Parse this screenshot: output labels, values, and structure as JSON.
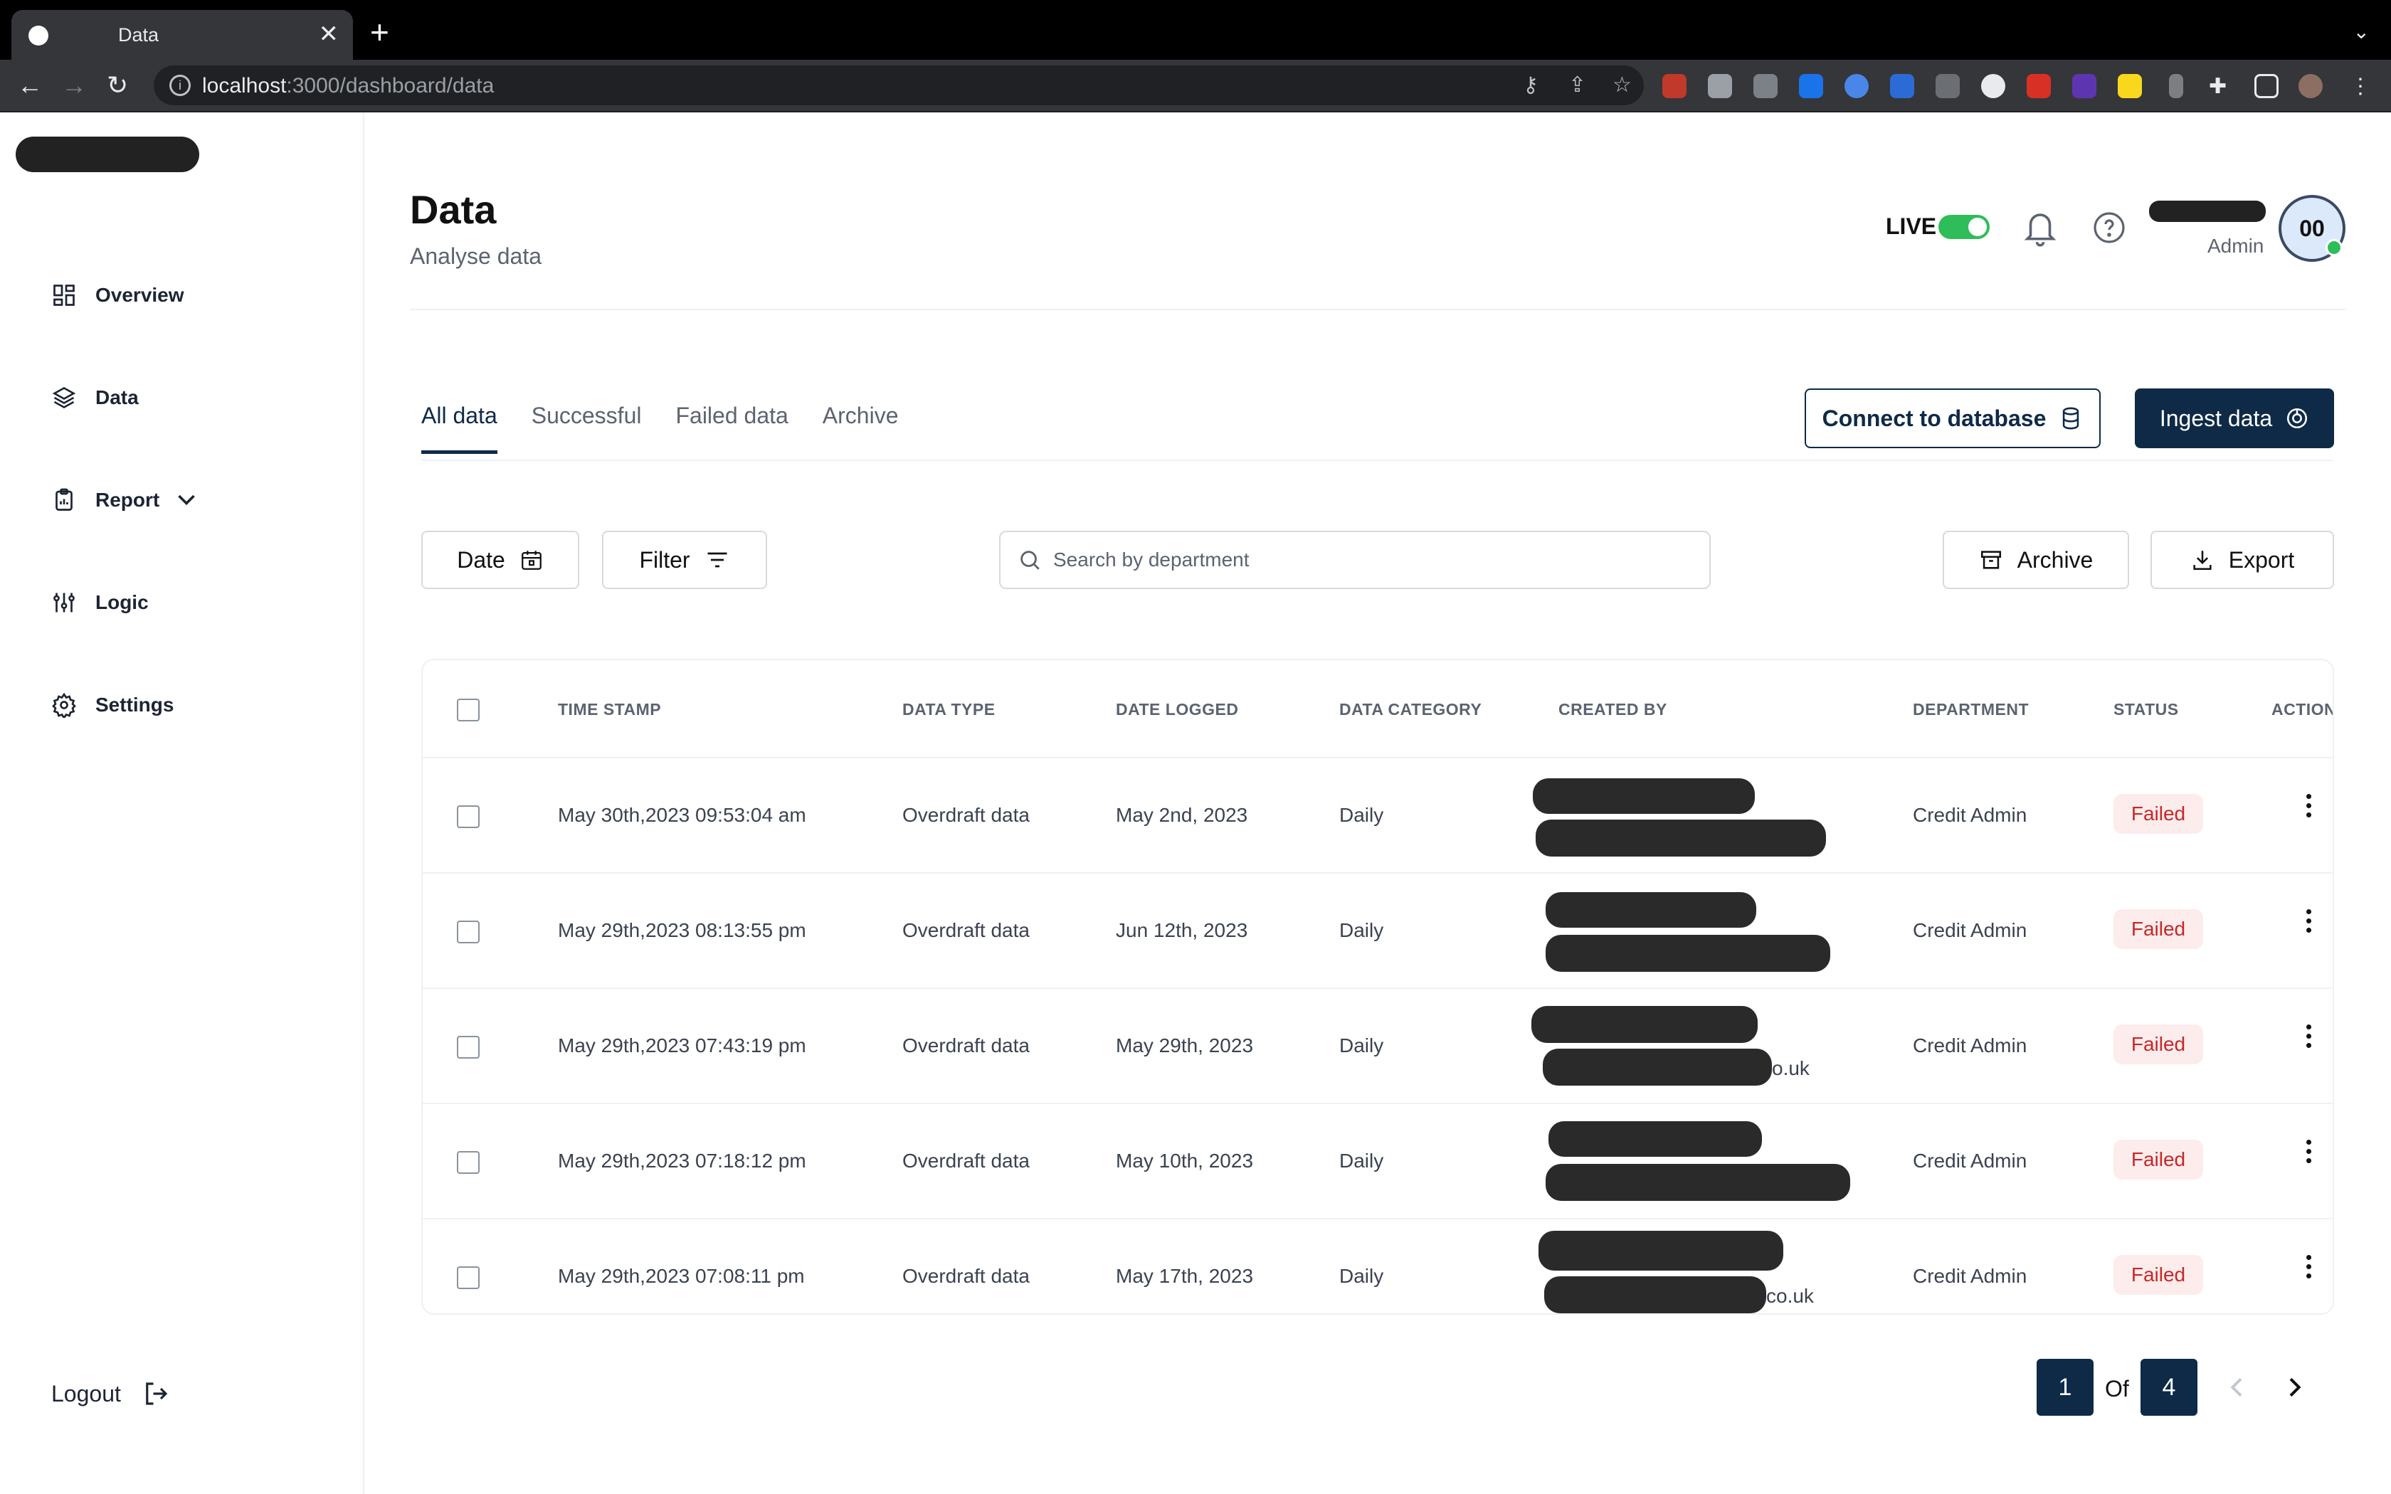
{
  "browser": {
    "tab_title": "Data",
    "url_host": "localhost",
    "url_path": ":3000/dashboard/data"
  },
  "sidebar": {
    "items": [
      {
        "label": "Overview",
        "icon": "grid-icon"
      },
      {
        "label": "Data",
        "icon": "layers-icon"
      },
      {
        "label": "Report",
        "icon": "clipboard-icon"
      },
      {
        "label": "Logic",
        "icon": "sliders-icon"
      },
      {
        "label": "Settings",
        "icon": "gear-icon"
      }
    ],
    "logout_label": "Logout"
  },
  "header": {
    "title": "Data",
    "subtitle": "Analyse data",
    "live_label": "LIVE",
    "live_on": true,
    "user_role": "Admin",
    "avatar_initials": "00"
  },
  "tabs": [
    "All data",
    "Successful",
    "Failed data",
    "Archive"
  ],
  "actions": {
    "connect_label": "Connect to database",
    "ingest_label": "Ingest data",
    "date_label": "Date",
    "filter_label": "Filter",
    "search_placeholder": "Search by department",
    "archive_label": "Archive",
    "export_label": "Export"
  },
  "table": {
    "headers": [
      "TIME STAMP",
      "DATA TYPE",
      "DATE LOGGED",
      "DATA CATEGORY",
      "CREATED BY",
      "DEPARTMENT",
      "STATUS",
      "ACTION"
    ],
    "rows": [
      {
        "timestamp": "May 30th,2023 09:53:04 am",
        "type": "Overdraft data",
        "logged": "May 2nd, 2023",
        "category": "Daily",
        "created_suffix": "",
        "department": "Credit Admin",
        "status": "Failed"
      },
      {
        "timestamp": "May 29th,2023 08:13:55 pm",
        "type": "Overdraft data",
        "logged": "Jun 12th, 2023",
        "category": "Daily",
        "created_suffix": "",
        "department": "Credit Admin",
        "status": "Failed"
      },
      {
        "timestamp": "May 29th,2023 07:43:19 pm",
        "type": "Overdraft data",
        "logged": "May 29th, 2023",
        "category": "Daily",
        "created_suffix": "o.uk",
        "department": "Credit Admin",
        "status": "Failed"
      },
      {
        "timestamp": "May 29th,2023 07:18:12 pm",
        "type": "Overdraft data",
        "logged": "May 10th, 2023",
        "category": "Daily",
        "created_suffix": "",
        "department": "Credit Admin",
        "status": "Failed"
      },
      {
        "timestamp": "May 29th,2023 07:08:11 pm",
        "type": "Overdraft data",
        "logged": "May 17th, 2023",
        "category": "Daily",
        "created_suffix": "co.uk",
        "department": "Credit Admin",
        "status": "Failed"
      }
    ]
  },
  "pagination": {
    "current": "1",
    "of_label": "Of",
    "total": "4"
  },
  "colors": {
    "primary": "#0e2a47",
    "live_green": "#2ebd59",
    "failed_red": "#c62828",
    "failed_bg": "#fdecec"
  }
}
